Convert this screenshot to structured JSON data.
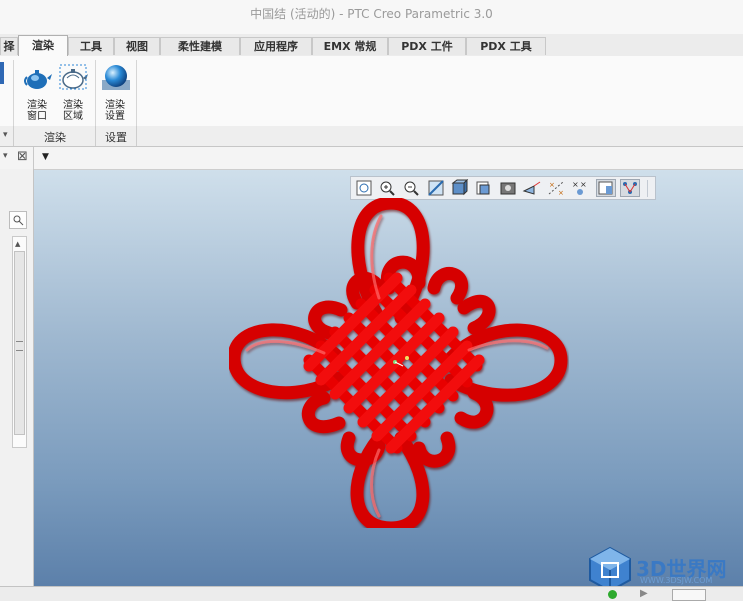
{
  "window": {
    "title": "中国结 (活动的) - PTC Creo Parametric 3.0"
  },
  "tabs": [
    {
      "label": "择"
    },
    {
      "label": "渲染"
    },
    {
      "label": "工具"
    },
    {
      "label": "视图"
    },
    {
      "label": "柔性建模"
    },
    {
      "label": "应用程序"
    },
    {
      "label": "EMX 常规"
    },
    {
      "label": "PDX 工件"
    },
    {
      "label": "PDX 工具"
    }
  ],
  "active_tab": "渲染",
  "ribbon": {
    "buttons": [
      {
        "line1": "渲染",
        "line2": "窗口",
        "icon": "teapot-render-window-icon"
      },
      {
        "line1": "渲染",
        "line2": "区域",
        "icon": "teapot-render-region-icon"
      },
      {
        "line1": "渲染",
        "line2": "设置",
        "icon": "sphere-render-setup-icon"
      }
    ],
    "groups": [
      {
        "label": "渲染"
      },
      {
        "label": "设置"
      }
    ]
  },
  "viewport_toolbar": {
    "icons": [
      "refit-icon",
      "zoom-in-icon",
      "zoom-out-icon",
      "repaint-icon",
      "display-style-icon",
      "saved-orientations-icon",
      "view-manager-icon",
      "perspective-view-icon",
      "datum-display-icon",
      "annotation-display-icon",
      "spin-center-icon",
      "model-tree-toggle-icon"
    ]
  },
  "model": {
    "name": "中国结",
    "color": "#ee0000"
  },
  "watermark": {
    "text": "3D世界网",
    "url": "WWW.3DSJW.COM"
  },
  "colors": {
    "viewport_top": "#cfdfeb",
    "viewport_bottom": "#5c80aa",
    "accent": "#3a79c4"
  }
}
